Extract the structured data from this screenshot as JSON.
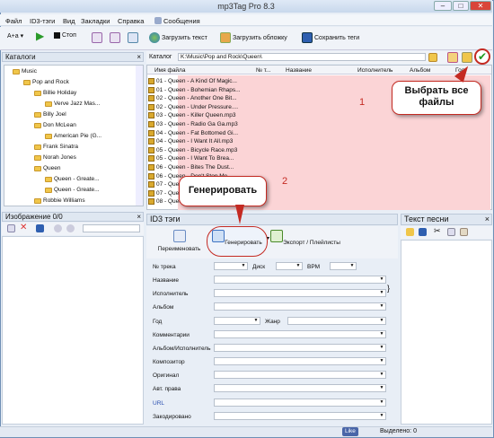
{
  "window": {
    "title": "mp3Tag Pro 8.3"
  },
  "menu": {
    "items": [
      "Файл",
      "ID3-тэги",
      "Вид",
      "Закладки",
      "Справка",
      "Сообщения"
    ]
  },
  "toolbar": {
    "mode": "A+a",
    "stop": "Стоп",
    "load_text": "Загрузить текст",
    "load_cover": "Загрузить обложку",
    "save_tags": "Сохранить теги"
  },
  "panels": {
    "catalogs": "Каталоги",
    "image": "Изображение 0/0",
    "id3": "ID3 тэги",
    "lyrics": "Текст песни"
  },
  "path": {
    "label": "Каталог",
    "value": "K:\\Music\\Pop and Rock\\Queen\\"
  },
  "tree": [
    {
      "label": "Music",
      "indent": 0
    },
    {
      "label": "Pop and Rock",
      "indent": 1
    },
    {
      "label": "Billie Holiday",
      "indent": 2
    },
    {
      "label": "Verve Jazz Mas...",
      "indent": 3
    },
    {
      "label": "Billy Joel",
      "indent": 2
    },
    {
      "label": "Don McLean",
      "indent": 2
    },
    {
      "label": "American Pie (G...",
      "indent": 3
    },
    {
      "label": "Frank Sinatra",
      "indent": 2
    },
    {
      "label": "Norah Jones",
      "indent": 2
    },
    {
      "label": "Queen",
      "indent": 2
    },
    {
      "label": "Queen - Greate...",
      "indent": 3
    },
    {
      "label": "Queen - Greate...",
      "indent": 3
    },
    {
      "label": "Robbie Williams",
      "indent": 2
    }
  ],
  "columns": [
    "Имя файла",
    "№ т...",
    "Название",
    "Исполнитель",
    "Альбом",
    "Год"
  ],
  "files": [
    "01 - Queen - A Kind Of Magic...",
    "01 - Queen - Bohemian Rhaps...",
    "02 - Queen - Another One Bit...",
    "02 - Queen - Under Pressure....",
    "03 - Queen - Killer Queen.mp3",
    "03 - Queen - Radio Ga Ga.mp3",
    "04 - Queen - Fat Bottomed Gi...",
    "04 - Queen - I Want It All.mp3",
    "05 - Queen - Bicycle Race.mp3",
    "05 - Queen - I Want To Brea...",
    "06 - Queen - Bites The Dust...",
    "06 - Queen - Don't Stop Me...",
    "07 - Queen - Who Wants...",
    "07 - Queen - ...",
    "08 - Queen - ..."
  ],
  "id3_tools": {
    "rename": "Переименовать",
    "generate": "Генерировать",
    "export": "Экспорт / Плейлисты"
  },
  "form": {
    "track": "№ трека",
    "disc": "Диск",
    "bpm": "BPM",
    "title": "Название",
    "artist": "Исполнитель",
    "album": "Альбом",
    "year": "Год",
    "genre": "Жанр",
    "comments": "Комментарии",
    "album_artist": "Альбом/Исполнитель",
    "composer": "Композитор",
    "original": "Оригинал",
    "copyright": "Авт. права",
    "url": "URL",
    "encoded": "Закодировано"
  },
  "callouts": {
    "select_all": "Выбрать все файлы",
    "generate": "Генерировать",
    "num1": "1",
    "num2": "2"
  },
  "status": {
    "like": "Like",
    "selected": "Выделено: 0"
  },
  "colors": {
    "selection": "#fbd4d6",
    "callout_border": "#c42a22",
    "accent": "#2a7a2a"
  }
}
